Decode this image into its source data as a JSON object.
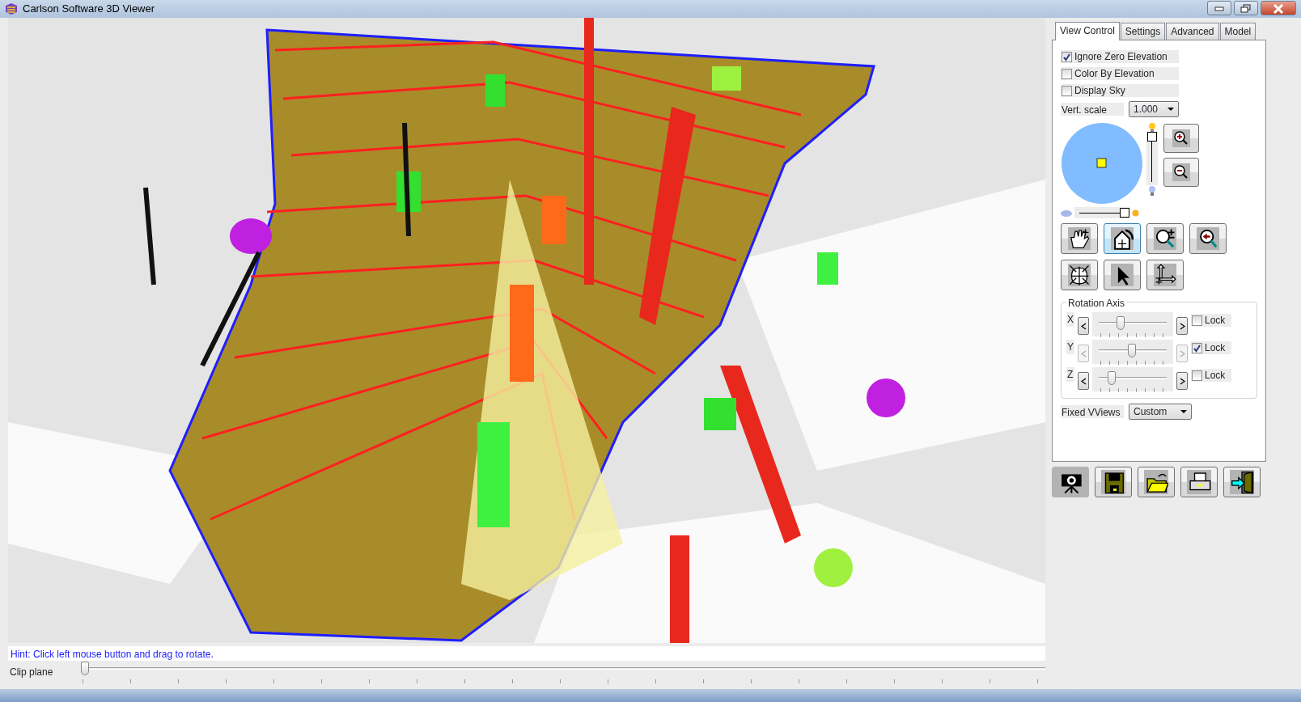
{
  "window": {
    "title": "Carlson Software 3D Viewer"
  },
  "tabs": [
    {
      "label": "View Control",
      "selected": true
    },
    {
      "label": "Settings",
      "selected": false
    },
    {
      "label": "Advanced",
      "selected": false
    },
    {
      "label": "Model",
      "selected": false
    }
  ],
  "options": [
    {
      "label": "Ignore Zero Elevation",
      "checked": true
    },
    {
      "label": "Color By Elevation",
      "checked": false
    },
    {
      "label": "Display Sky",
      "checked": false
    }
  ],
  "vert_scale": {
    "label": "Vert. scale",
    "value": "1.000"
  },
  "light": {
    "vertical_slider": {
      "level": 1
    },
    "horizontal_slider": {
      "level": 1
    }
  },
  "zoom_buttons": [
    {
      "kind": "zoom-in"
    },
    {
      "kind": "zoom-out"
    }
  ],
  "tools": [
    {
      "kind": "pan",
      "selected": false
    },
    {
      "kind": "rotate",
      "selected": true
    },
    {
      "kind": "zoom-extents",
      "selected": false
    },
    {
      "kind": "zoom-previous",
      "selected": false
    },
    {
      "kind": "mesh",
      "selected": false
    },
    {
      "kind": "select",
      "selected": false
    },
    {
      "kind": "axes",
      "selected": false
    }
  ],
  "rotation_axis": {
    "title": "Rotation Axis",
    "axes": [
      {
        "label": "X",
        "level": 0.3,
        "locked": false,
        "lock_label": "Lock"
      },
      {
        "label": "Y",
        "level": 0.5,
        "locked": true,
        "lock_label": "Lock"
      },
      {
        "label": "Z",
        "level": 0.15,
        "locked": false,
        "lock_label": "Lock"
      }
    ]
  },
  "fixed_views": {
    "label": "Fixed VViews",
    "value": "Custom"
  },
  "bottom_buttons": [
    {
      "kind": "camera",
      "selected": true
    },
    {
      "kind": "save",
      "selected": false
    },
    {
      "kind": "open",
      "selected": false
    },
    {
      "kind": "print",
      "selected": false
    },
    {
      "kind": "exit",
      "selected": false
    }
  ],
  "hint": "Hint: Click left mouse button and drag to rotate.",
  "clip_plane": {
    "label": "Clip plane",
    "level": 0
  }
}
